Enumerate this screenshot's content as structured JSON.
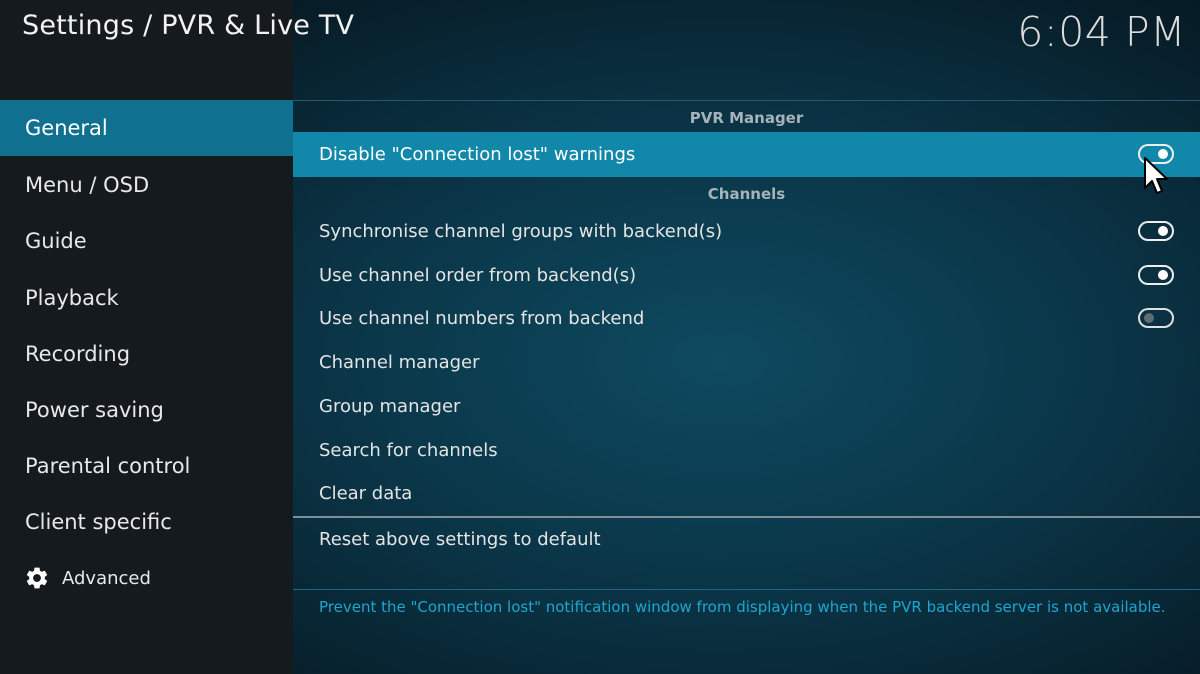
{
  "header": {
    "title": "Settings / PVR & Live TV",
    "clock": "6:04 PM"
  },
  "sidebar": {
    "items": [
      {
        "label": "General"
      },
      {
        "label": "Menu / OSD"
      },
      {
        "label": "Guide"
      },
      {
        "label": "Playback"
      },
      {
        "label": "Recording"
      },
      {
        "label": "Power saving"
      },
      {
        "label": "Parental control"
      },
      {
        "label": "Client specific"
      }
    ],
    "advanced_label": "Advanced",
    "advanced_icon": "gear-icon",
    "active_index": 0
  },
  "main": {
    "sections": {
      "pvr_manager": "PVR Manager",
      "channels": "Channels"
    },
    "settings": [
      {
        "label": "Disable \"Connection lost\" warnings",
        "toggle": true
      },
      {
        "label": "Synchronise channel groups with backend(s)",
        "toggle": true
      },
      {
        "label": "Use channel order from backend(s)",
        "toggle": true
      },
      {
        "label": "Use channel numbers from backend",
        "toggle": false
      },
      {
        "label": "Channel manager"
      },
      {
        "label": "Group manager"
      },
      {
        "label": "Search for channels"
      },
      {
        "label": "Clear data"
      }
    ],
    "reset_label": "Reset above settings to default",
    "help_text": "Prevent the \"Connection lost\" notification window from displaying when the PVR backend server is not available."
  },
  "colors": {
    "accent": "#1187aa",
    "sidebar_active": "#10708f",
    "help_text": "#1ea6d0"
  }
}
